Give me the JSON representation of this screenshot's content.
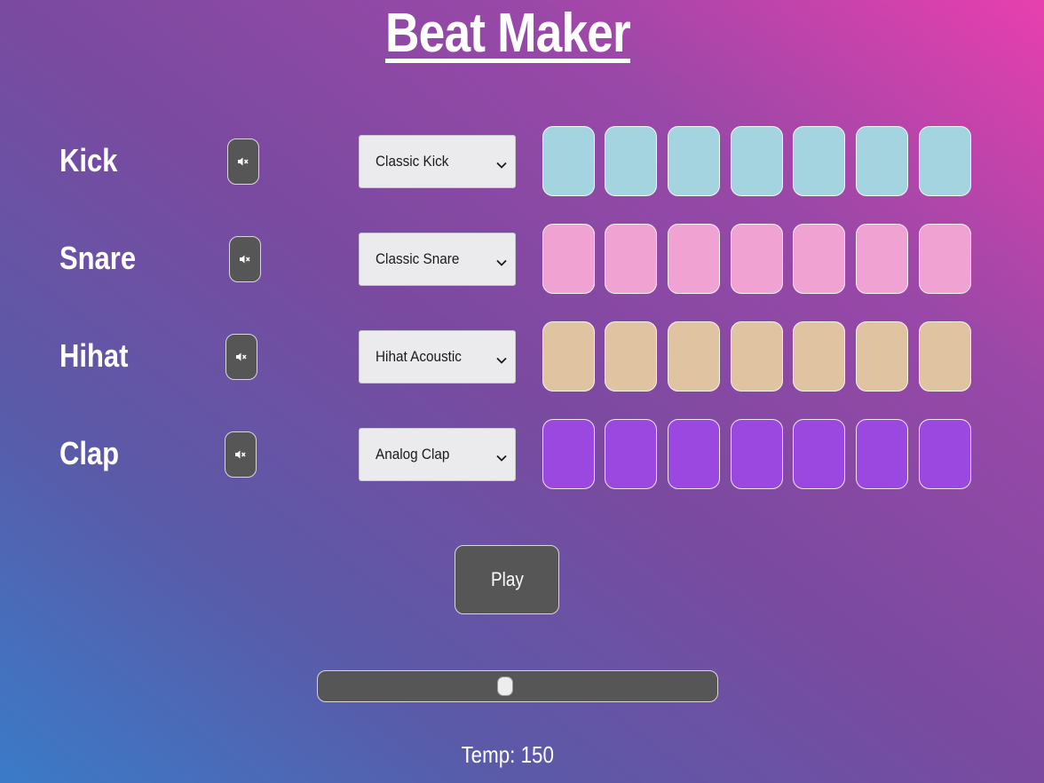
{
  "app": {
    "title": "Beat Maker"
  },
  "tracks": [
    {
      "name": "Kick",
      "mute_icon": "speaker-mute-icon",
      "selected_sound": "Classic Kick",
      "pad_color": "#a3d4e0",
      "steps": 7
    },
    {
      "name": "Snare",
      "mute_icon": "speaker-mute-icon",
      "selected_sound": "Classic Snare",
      "pad_color": "#f0a2d2",
      "steps": 7
    },
    {
      "name": "Hihat",
      "mute_icon": "speaker-mute-icon",
      "selected_sound": "Hihat Acoustic",
      "pad_color": "#e0c4a2",
      "steps": 7
    },
    {
      "name": "Clap",
      "mute_icon": "speaker-mute-icon",
      "selected_sound": "Analog Clap",
      "pad_color": "#9a48e0",
      "steps": 7
    }
  ],
  "controls": {
    "play_label": "Play",
    "tempo_label": "Temp: 150",
    "tempo_value": 150,
    "tempo_fraction": 0.47
  },
  "colors": {
    "button_bg": "#565656",
    "select_bg": "#ebebee",
    "gradient_start": "#3a7bc8",
    "gradient_end": "#e83fae"
  }
}
